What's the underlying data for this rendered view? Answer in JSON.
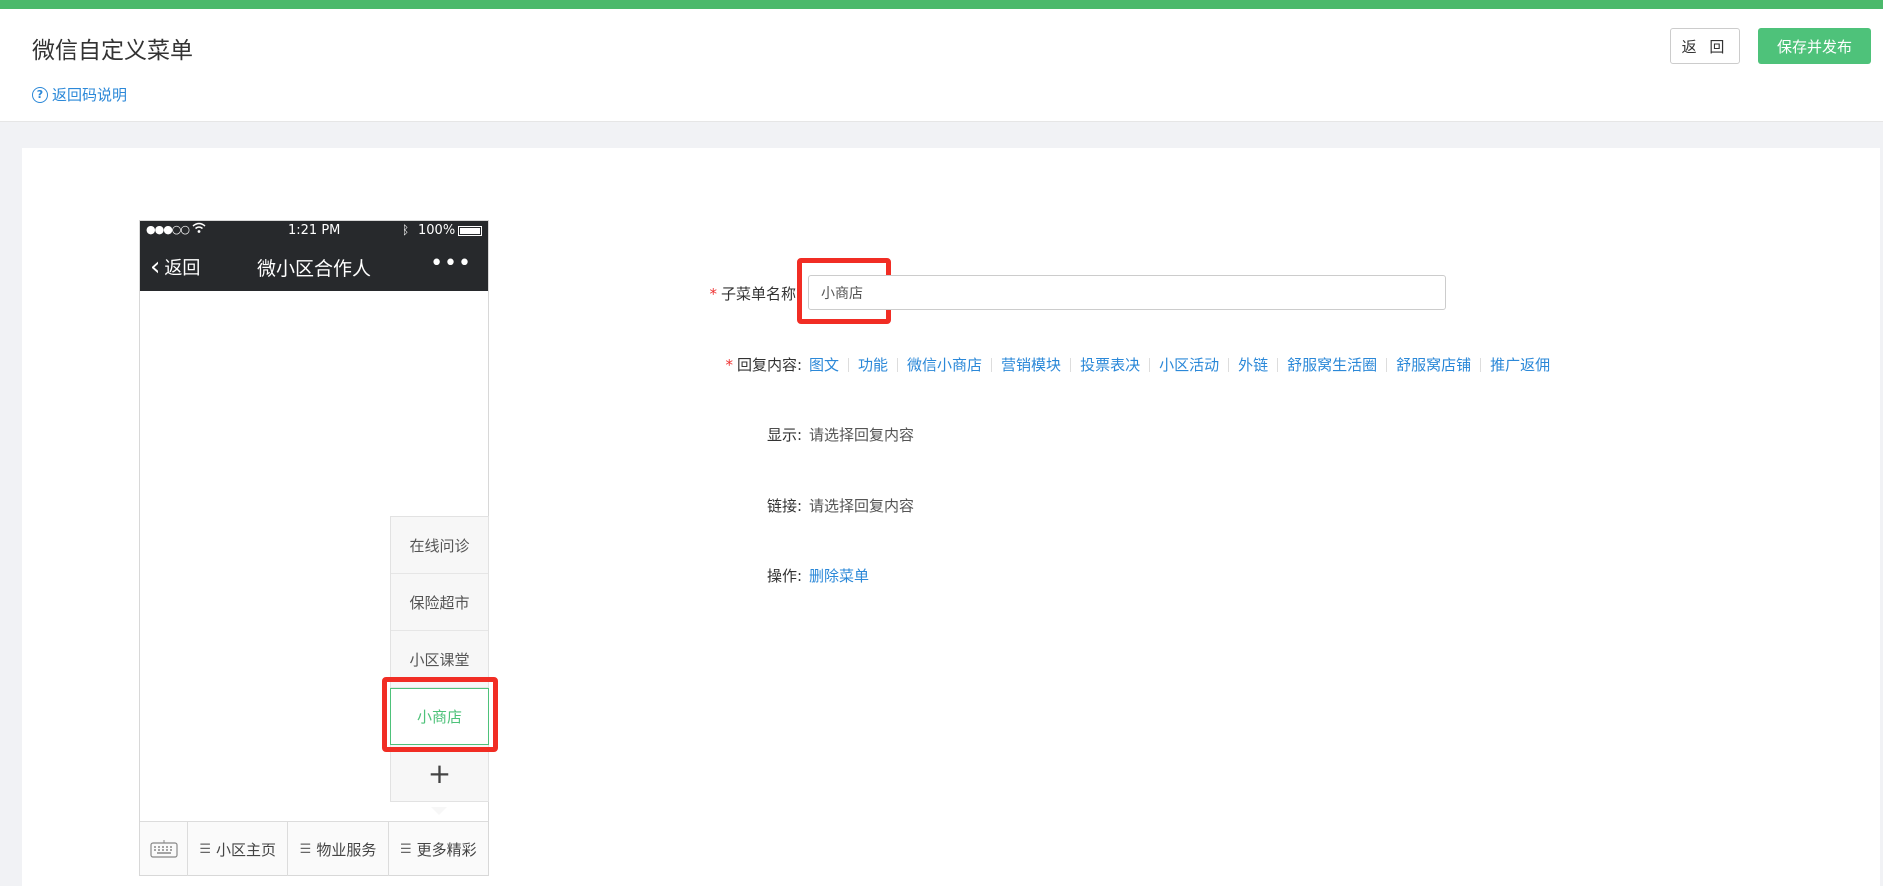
{
  "header": {
    "title": "微信自定义菜单",
    "help_link": "返回码说明",
    "help_icon": "question-circle-icon",
    "back_button": "返 回",
    "save_button": "保存并发布"
  },
  "colors": {
    "accent_green": "#4ec27a",
    "link_blue": "#2b88d8",
    "highlight_red": "#f12d24",
    "phone_header": "#27292c"
  },
  "phone": {
    "status": {
      "signal": "●●●○○",
      "time": "1:21 PM",
      "battery": "100%"
    },
    "nav": {
      "back_label": "返回",
      "title": "微小区合作人",
      "more": "•••"
    },
    "submenu": {
      "items": [
        {
          "label": "在线问诊",
          "active": false
        },
        {
          "label": "保险超市",
          "active": false
        },
        {
          "label": "小区课堂",
          "active": false
        },
        {
          "label": "小商店",
          "active": true
        }
      ],
      "add": "+"
    },
    "bottom_menu": {
      "keyboard_icon": "keyboard-icon",
      "tabs": [
        "小区主页",
        "物业服务",
        "更多精彩"
      ]
    }
  },
  "form": {
    "name_label": "子菜单名称",
    "name_value": "小商店",
    "reply_label": "回复内容:",
    "reply_options": [
      "图文",
      "功能",
      "微信小商店",
      "营销模块",
      "投票表决",
      "小区活动",
      "外链",
      "舒服窝生活圈",
      "舒服窝店铺",
      "推广返佣"
    ],
    "display_label": "显示:",
    "display_value": "请选择回复内容",
    "link_label": "链接:",
    "link_value": "请选择回复内容",
    "action_label": "操作:",
    "delete_link": "删除菜单"
  }
}
